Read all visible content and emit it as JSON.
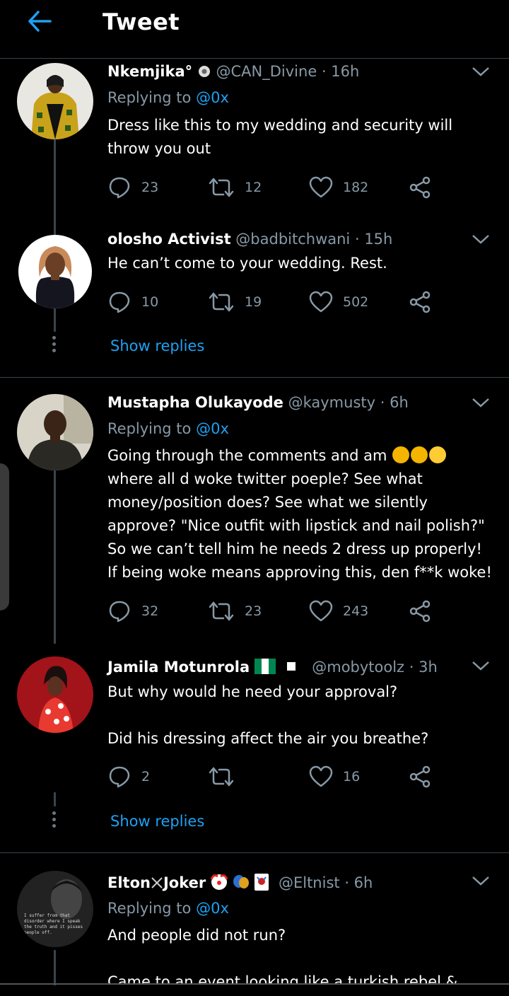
{
  "header": {
    "title": "Tweet"
  },
  "tweets": [
    {
      "name": "Nkemjika",
      "name_suffix": "°",
      "handle": "@CAN_Divine",
      "time": "· 16h",
      "replying_label": "Replying to",
      "replying_to": "@0x",
      "text": "Dress like this to my wedding and security will throw you out",
      "replies": "23",
      "retweets": "12",
      "likes": "182"
    },
    {
      "name": "olosho Activist",
      "handle": "@badbitchwani",
      "time": "· 15h",
      "text": "He can’t come to your wedding. Rest.",
      "replies": "10",
      "retweets": "19",
      "likes": "502"
    },
    {
      "name": "Mustapha Olukayode",
      "handle": "@kaymusty",
      "time": "· 6h",
      "replying_label": "Replying to",
      "replying_to": "@0x",
      "text_a": "Going through the comments and am",
      "text_b": "where all d woke twitter poeple? See what money/position does? See what we silently approve? \"Nice outfit with lipstick and nail polish?\" So we can’t tell him he needs 2 dress up properly! If being woke means approving this, den f**k woke!",
      "replies": "32",
      "retweets": "23",
      "likes": "243"
    },
    {
      "name": "Jamila Motunrola",
      "handle": "@mobytoolz",
      "time": "· 3h",
      "text_a": "But why would he need your approval?",
      "text_b": "Did his dressing affect the air you breathe?",
      "replies": "2",
      "retweets": "",
      "likes": "16"
    },
    {
      "name": "Elton",
      "name_b": "Joker",
      "handle": "@Eltnist",
      "time": "· 6h",
      "replying_label": "Replying to",
      "replying_to": "@0x",
      "text": "And people did not run?",
      "text_cut": "Came to an event looking like a turkish rebel & people"
    }
  ],
  "show_replies": "Show replies",
  "avatar_caption": "I suffer from that disorder where I speak the truth and it pisses people off.",
  "colors": {
    "background": "#000000",
    "accent": "#1da1f2",
    "muted": "#8899a6",
    "divider": "#38444d"
  }
}
